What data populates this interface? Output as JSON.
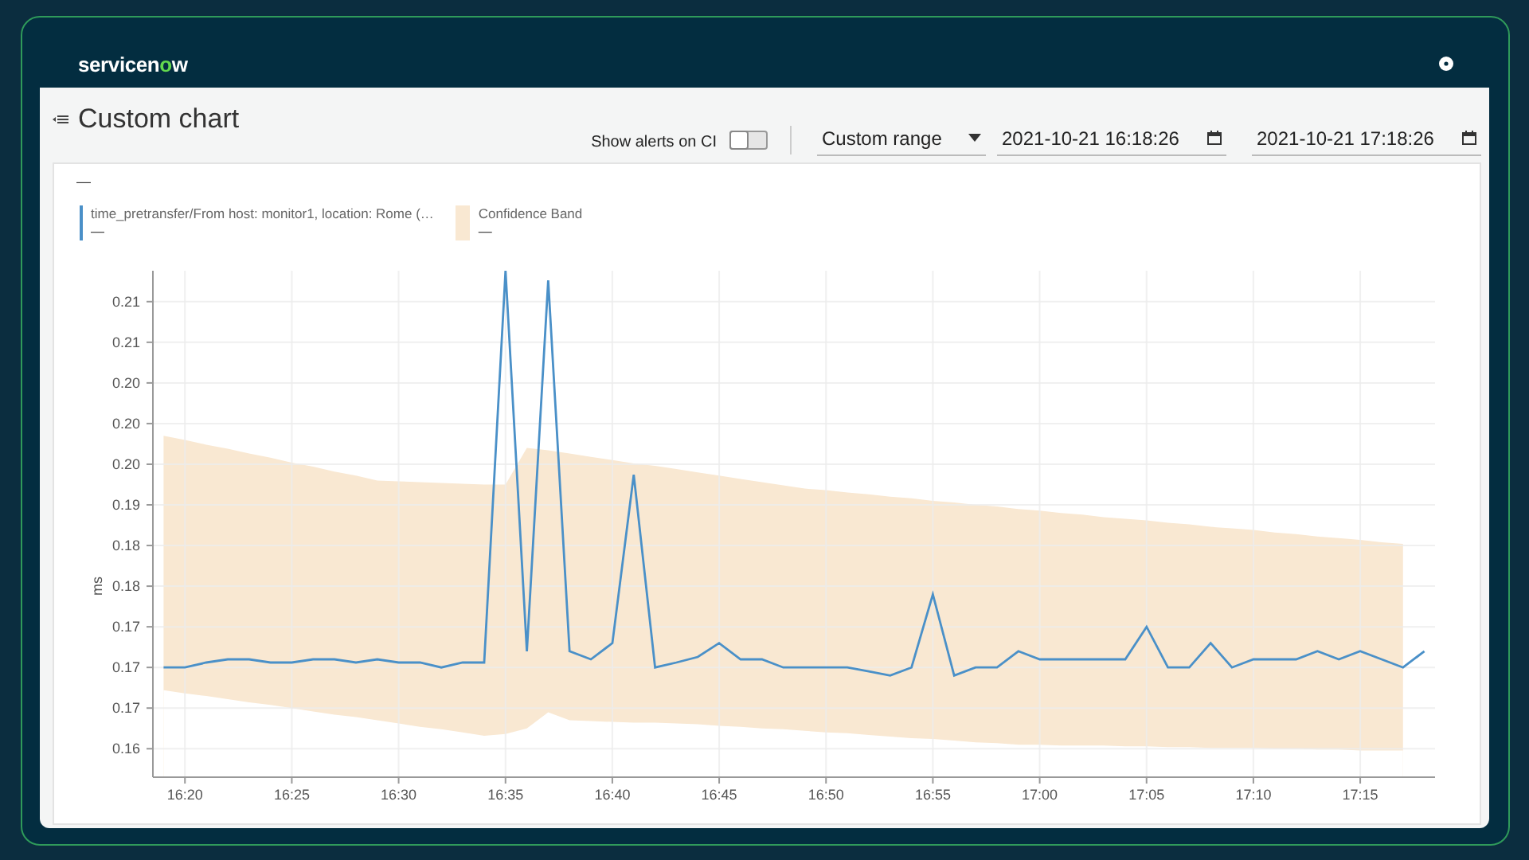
{
  "header": {
    "logo": {
      "text_before": "servicen",
      "text_accent": "o",
      "text_after": "w"
    }
  },
  "page": {
    "title": "Custom chart"
  },
  "toolbar": {
    "toggle": {
      "label": "Show alerts on CI",
      "on": false
    },
    "range_select": {
      "value": "Custom range"
    },
    "start_field": {
      "value": "2021-10-21 16:18:26"
    },
    "end_field": {
      "value": "2021-10-21 17:18:26"
    }
  },
  "chart": {
    "legend_dash": "—",
    "legend": [
      {
        "kind": "line",
        "value": "—"
      },
      {
        "kind": "band",
        "value": "—"
      }
    ],
    "chart_data": {
      "type": "line",
      "ylabel": "ms",
      "grid": true,
      "categories": [
        null,
        "16:20",
        null,
        null,
        null,
        null,
        "16:25",
        null,
        null,
        null,
        null,
        "16:30",
        null,
        null,
        null,
        null,
        "16:35",
        null,
        null,
        null,
        null,
        "16:40",
        null,
        null,
        null,
        null,
        "16:45",
        null,
        null,
        null,
        null,
        "16:50",
        null,
        null,
        null,
        null,
        "16:55",
        null,
        null,
        null,
        null,
        "17:00",
        null,
        null,
        null,
        null,
        "17:05",
        null,
        null,
        null,
        null,
        "17:10",
        null,
        null,
        null,
        null,
        "17:15",
        null,
        null,
        null
      ],
      "series": [
        {
          "name": "time_pretransfer/From host: monitor1, location: Rome (…",
          "color": "#4a90c8",
          "values": [
            0.17,
            0.17,
            0.1706,
            0.171,
            0.171,
            0.1706,
            0.1706,
            0.171,
            0.171,
            0.1706,
            0.171,
            0.1706,
            0.1706,
            0.17,
            0.1706,
            0.1706,
            0.2188,
            0.172,
            0.2176,
            0.172,
            0.171,
            0.173,
            0.1937,
            0.17,
            0.1706,
            0.1713,
            0.173,
            0.171,
            0.171,
            0.17,
            0.17,
            0.17,
            0.17,
            0.1695,
            0.169,
            0.17,
            0.179,
            0.169,
            0.17,
            0.17,
            0.172,
            0.171,
            0.171,
            0.171,
            0.171,
            0.171,
            0.175,
            0.17,
            0.17,
            0.173,
            0.17,
            0.171,
            0.171,
            0.171,
            0.172,
            0.171,
            0.172,
            0.171,
            0.17,
            0.172
          ]
        },
        {
          "type": "area",
          "name": "Confidence Band",
          "color": "#f9e8d2",
          "values": [
            0.1985,
            0.198,
            0.1974,
            0.1969,
            0.1963,
            0.1958,
            0.1952,
            0.1947,
            0.1941,
            0.1936,
            0.193,
            0.1929,
            0.1928,
            0.1927,
            0.1926,
            0.1925,
            0.1925,
            0.197,
            0.1967,
            0.1963,
            0.1959,
            0.1955,
            0.1951,
            0.1948,
            0.1944,
            0.194,
            0.1936,
            0.1932,
            0.1928,
            0.1924,
            0.192,
            0.1918,
            0.1915,
            0.1913,
            0.191,
            0.1908,
            0.1905,
            0.1903,
            0.19,
            0.1898,
            0.1895,
            0.1893,
            0.189,
            0.1888,
            0.1885,
            0.1883,
            0.1881,
            0.1878,
            0.1876,
            0.1873,
            0.1871,
            0.1869,
            0.1866,
            0.1864,
            0.1861,
            0.1859,
            0.1857,
            0.1854,
            0.1852,
            null
          ]
        },
        {
          "type": "area",
          "color": "#ffffff",
          "values": [
            0.1672,
            0.1668,
            0.1665,
            0.1661,
            0.1657,
            0.1654,
            0.165,
            0.1646,
            0.1642,
            0.1639,
            0.1635,
            0.1631,
            0.1627,
            0.1624,
            0.162,
            0.1616,
            0.1618,
            0.1625,
            0.1645,
            0.1635,
            0.1634,
            0.1633,
            0.1632,
            0.1632,
            0.1631,
            0.163,
            0.1628,
            0.1627,
            0.1625,
            0.1624,
            0.1622,
            0.162,
            0.1619,
            0.1617,
            0.1615,
            0.1613,
            0.1612,
            0.161,
            0.1608,
            0.1607,
            0.1605,
            0.1605,
            0.1604,
            0.1604,
            0.1604,
            0.1603,
            0.1603,
            0.1602,
            0.1602,
            0.1601,
            0.1601,
            0.1601,
            0.16,
            0.16,
            0.1599,
            0.1599,
            0.1598,
            0.1598,
            0.1598,
            null
          ]
        }
      ],
      "ylim": [
        0.1565,
        0.2188
      ],
      "yticks": [
        {
          "value": 0.16,
          "label": "0.16"
        },
        {
          "value": 0.165,
          "label": "0.17"
        },
        {
          "value": 0.17,
          "label": "0.17"
        },
        {
          "value": 0.175,
          "label": "0.17"
        },
        {
          "value": 0.18,
          "label": "0.18"
        },
        {
          "value": 0.185,
          "label": "0.18"
        },
        {
          "value": 0.19,
          "label": "0.19"
        },
        {
          "value": 0.195,
          "label": "0.20"
        },
        {
          "value": 0.2,
          "label": "0.20"
        },
        {
          "value": 0.205,
          "label": "0.20"
        },
        {
          "value": 0.21,
          "label": "0.21"
        },
        {
          "value": 0.215,
          "label": "0.21"
        }
      ]
    }
  }
}
